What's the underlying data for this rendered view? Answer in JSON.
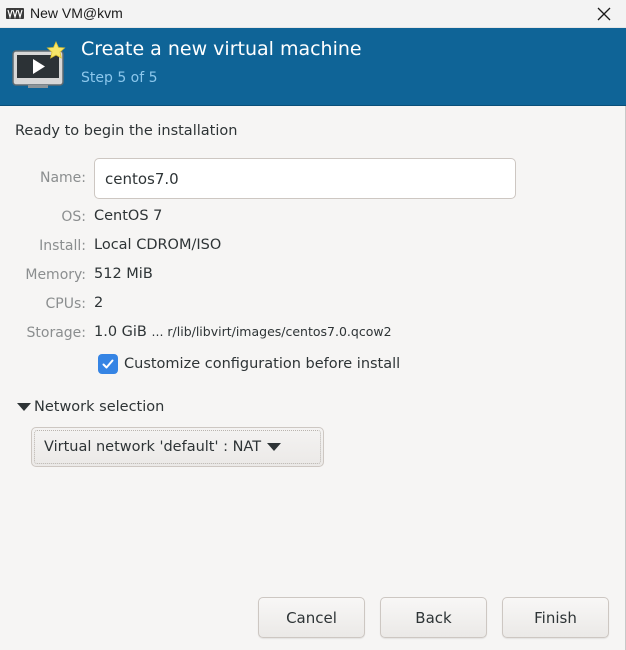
{
  "window": {
    "title": "New VM@kvm",
    "icons": {
      "app": "virt-manager-icon",
      "close": "close-icon"
    }
  },
  "banner": {
    "title": "Create a new virtual machine",
    "step": "Step 5 of 5",
    "icon": "new-vm-icon",
    "background_color": "#0f6497",
    "step_color": "#8cc7ec"
  },
  "summary": {
    "heading": "Ready to begin the installation",
    "name_label": "Name:",
    "name_value": "centos7.0",
    "os_label": "OS:",
    "os_value": "CentOS 7",
    "install_label": "Install:",
    "install_value": "Local CDROM/ISO",
    "memory_label": "Memory:",
    "memory_value": "512 MiB",
    "cpus_label": "CPUs:",
    "cpus_value": "2",
    "storage_label": "Storage:",
    "storage_size": "1.0 GiB",
    "storage_path": "... r/lib/libvirt/images/centos7.0.qcow2"
  },
  "customize": {
    "label": "Customize configuration before install",
    "checked": true,
    "accent_color": "#3584e4"
  },
  "network": {
    "expander_label": "Network selection",
    "expanded": true,
    "selected": "Virtual network 'default' : NAT"
  },
  "buttons": {
    "cancel": "Cancel",
    "back": "Back",
    "finish": "Finish"
  }
}
